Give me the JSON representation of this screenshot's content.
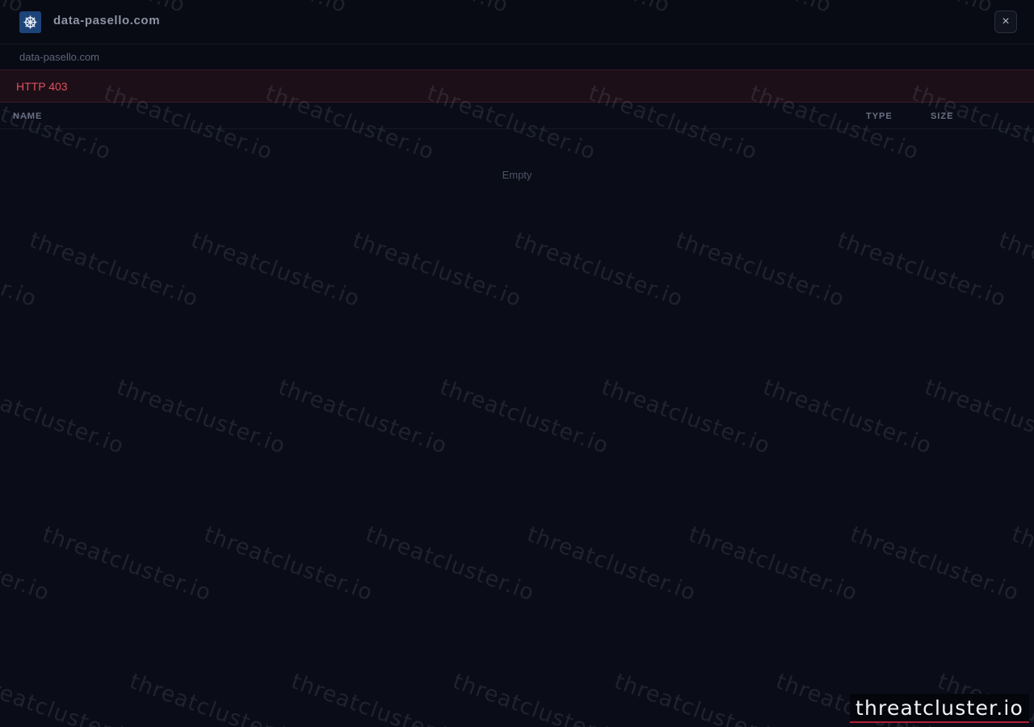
{
  "window": {
    "title": "data-pasello.com",
    "close_label": "×"
  },
  "breadcrumb": {
    "path": "data-pasello.com"
  },
  "error": {
    "message": "HTTP 403"
  },
  "table": {
    "columns": {
      "name": "NAME",
      "type": "TYPE",
      "size": "SIZE"
    },
    "empty_text": "Empty"
  },
  "watermark": {
    "text": "threatcluster.io"
  },
  "brand": {
    "badge_text": "threatcluster.io"
  },
  "colors": {
    "background": "#0a0c17",
    "error_text": "#e0505e",
    "error_bg": "#1c0f18",
    "logo_bg": "#1d4479",
    "brand_underline": "#b0203a"
  },
  "icons": {
    "logo": "helm-wheel-icon",
    "close": "close-icon"
  }
}
